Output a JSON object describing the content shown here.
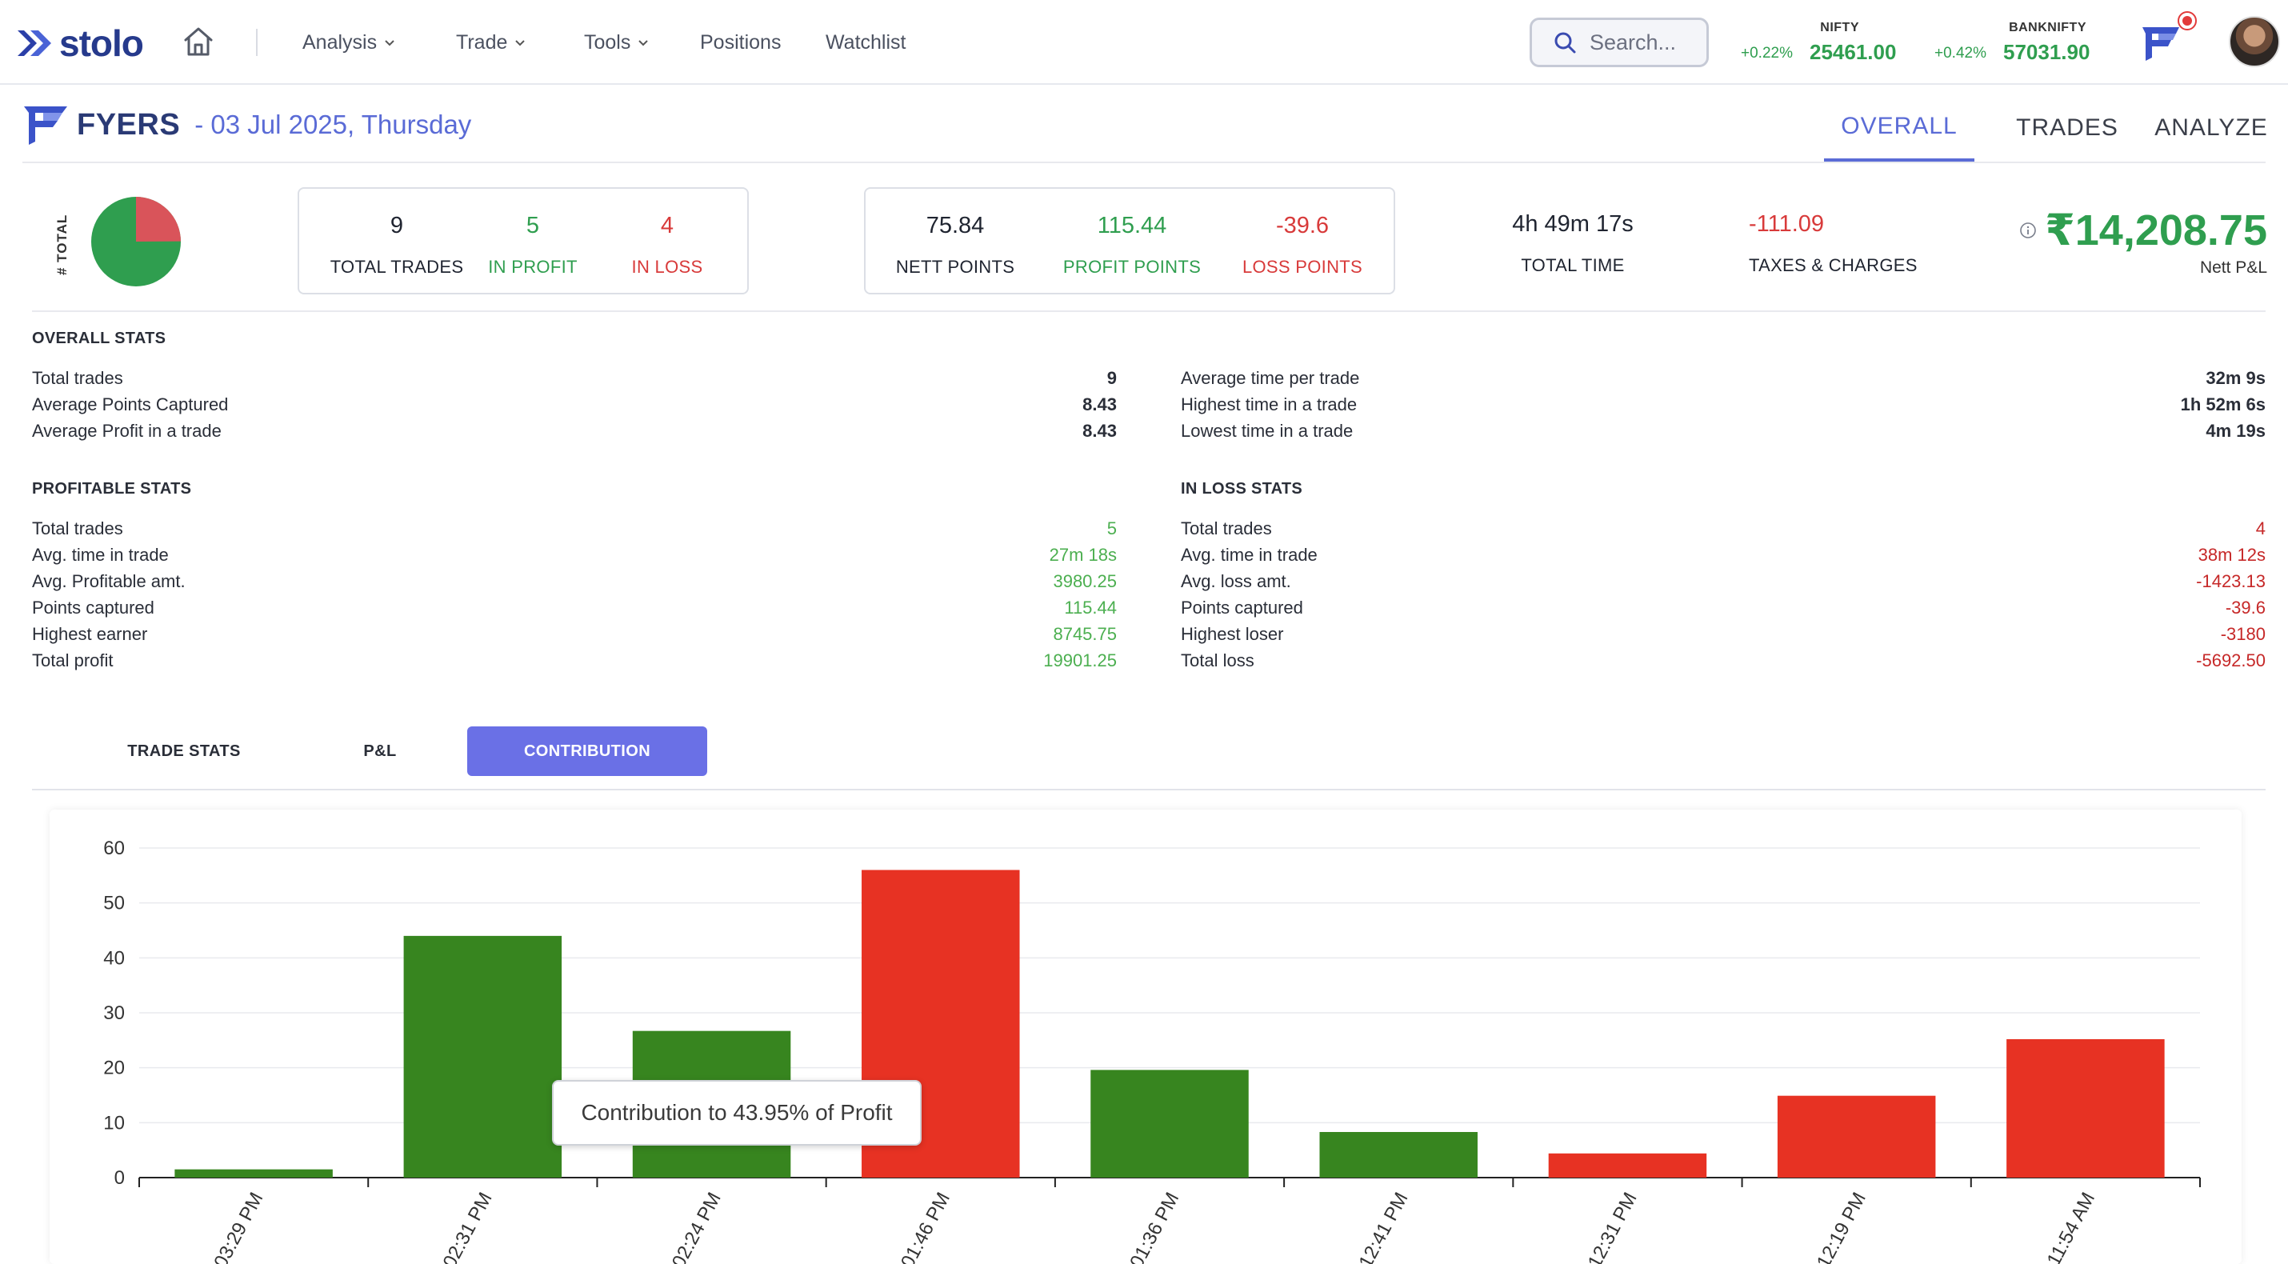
{
  "nav": {
    "brand": "stolo",
    "items": [
      {
        "label": "Analysis",
        "has_dropdown": true
      },
      {
        "label": "Trade",
        "has_dropdown": true
      },
      {
        "label": "Tools",
        "has_dropdown": true
      },
      {
        "label": "Positions",
        "has_dropdown": false
      },
      {
        "label": "Watchlist",
        "has_dropdown": false
      }
    ],
    "search_placeholder": "Search...",
    "indices": [
      {
        "name": "NIFTY",
        "change": "+0.22%",
        "value": "25461.00"
      },
      {
        "name": "BANKNIFTY",
        "change": "+0.42%",
        "value": "57031.90"
      }
    ]
  },
  "header": {
    "broker": "FYERS",
    "date": "- 03 Jul 2025, Thursday",
    "tabs": [
      {
        "label": "OVERALL",
        "active": true
      },
      {
        "label": "TRADES",
        "active": false
      },
      {
        "label": "ANALYZE",
        "active": false
      }
    ]
  },
  "summary": {
    "pie_label": "# TOTAL",
    "pie": {
      "profit": 5,
      "loss": 4
    },
    "trades_card": [
      {
        "value": "9",
        "label": "TOTAL TRADES",
        "tone": "dark"
      },
      {
        "value": "5",
        "label": "IN PROFIT",
        "tone": "green"
      },
      {
        "value": "4",
        "label": "IN LOSS",
        "tone": "red"
      }
    ],
    "points_card": [
      {
        "value": "75.84",
        "label": "NETT POINTS",
        "tone": "dark"
      },
      {
        "value": "115.44",
        "label": "PROFIT POINTS",
        "tone": "green"
      },
      {
        "value": "-39.6",
        "label": "LOSS POINTS",
        "tone": "red"
      }
    ],
    "total_time": {
      "value": "4h 49m 17s",
      "label": "TOTAL TIME"
    },
    "taxes": {
      "value": "-111.09",
      "label": "TAXES & CHARGES"
    },
    "nett_pl": {
      "value": "₹14,208.75",
      "label": "Nett P&L"
    }
  },
  "overall_stats": {
    "title": "OVERALL STATS",
    "left": [
      {
        "label": "Total trades",
        "value": "9"
      },
      {
        "label": "Average Points Captured",
        "value": "8.43"
      },
      {
        "label": "Average Profit in a trade",
        "value": "8.43"
      }
    ],
    "right": [
      {
        "label": "Average time per trade",
        "value": "32m 9s"
      },
      {
        "label": "Highest time in a trade",
        "value": "1h 52m 6s"
      },
      {
        "label": "Lowest time in a trade",
        "value": "4m 19s"
      }
    ]
  },
  "profitable_stats": {
    "title": "PROFITABLE STATS",
    "rows": [
      {
        "label": "Total trades",
        "value": "5"
      },
      {
        "label": "Avg. time in trade",
        "value": "27m 18s"
      },
      {
        "label": "Avg. Profitable amt.",
        "value": "3980.25"
      },
      {
        "label": "Points captured",
        "value": "115.44"
      },
      {
        "label": "Highest earner",
        "value": "8745.75"
      },
      {
        "label": "Total profit",
        "value": "19901.25"
      }
    ]
  },
  "loss_stats": {
    "title": "IN LOSS STATS",
    "rows": [
      {
        "label": "Total trades",
        "value": "4"
      },
      {
        "label": "Avg. time in trade",
        "value": "38m 12s"
      },
      {
        "label": "Avg. loss amt.",
        "value": "-1423.13"
      },
      {
        "label": "Points captured",
        "value": "-39.6"
      },
      {
        "label": "Highest loser",
        "value": "-3180"
      },
      {
        "label": "Total loss",
        "value": "-5692.50"
      }
    ]
  },
  "subtabs": [
    {
      "label": "TRADE STATS",
      "active": false
    },
    {
      "label": "P&L",
      "active": false
    },
    {
      "label": "CONTRIBUTION",
      "active": true
    }
  ],
  "tooltip": "Contribution to 43.95% of Profit",
  "colors": {
    "accent": "#5a6bd6",
    "profit": "#2f9e4f",
    "loss": "#d83a3a",
    "bar_profit": "#37851f",
    "bar_loss": "#e73223"
  },
  "chart_data": {
    "type": "bar",
    "categories": [
      "03:29 PM",
      "02:31 PM",
      "02:24 PM",
      "01:46 PM",
      "01:36 PM",
      "12:41 PM",
      "12:31 PM",
      "12:19 PM",
      "11:54 AM"
    ],
    "values": [
      1.5,
      44,
      26.7,
      56,
      19.6,
      8.3,
      4.4,
      14.9,
      25.2
    ],
    "status": [
      "profit",
      "profit",
      "profit",
      "loss",
      "profit",
      "profit",
      "loss",
      "loss",
      "loss"
    ],
    "y_ticks": [
      "0",
      "10",
      "20",
      "30",
      "40",
      "50",
      "60"
    ],
    "ylim": [
      0,
      60
    ],
    "grid": true,
    "title": "",
    "xlabel": "",
    "ylabel": ""
  }
}
